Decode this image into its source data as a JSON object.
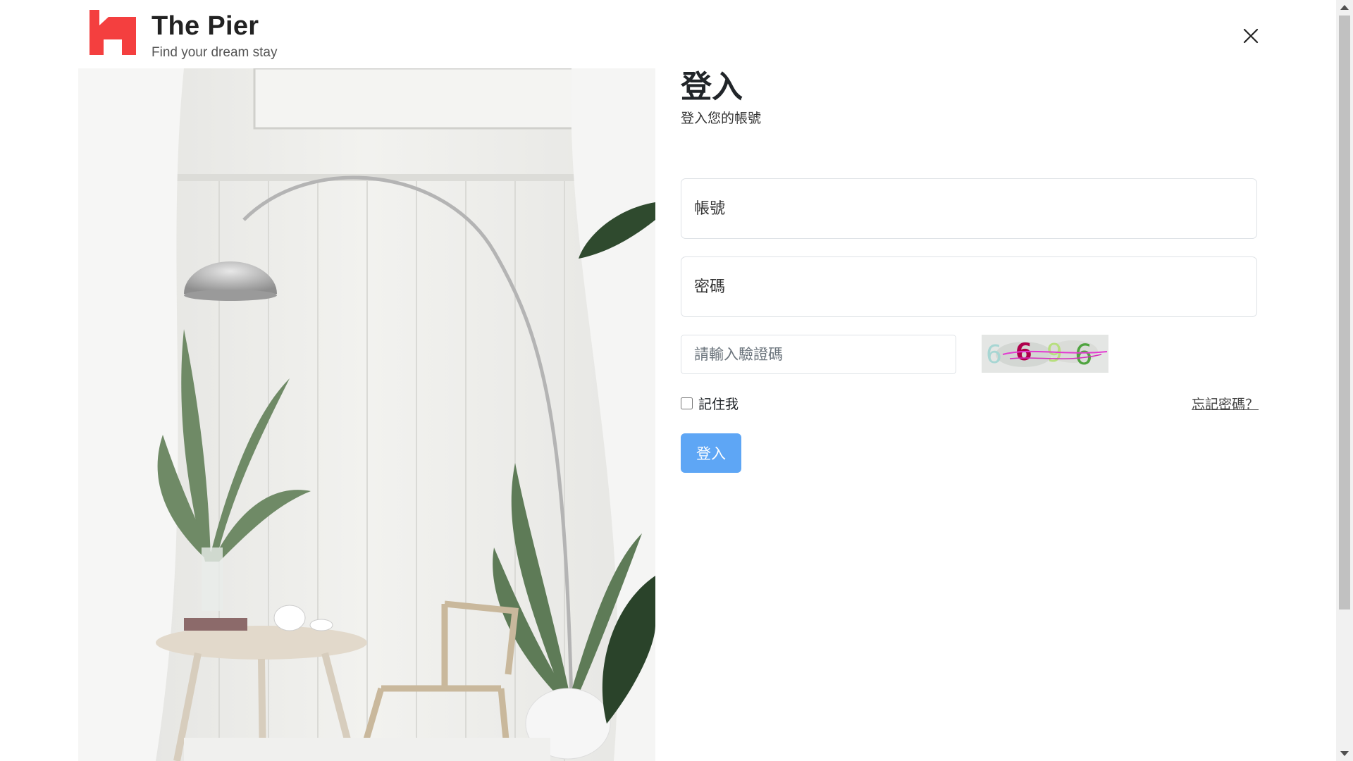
{
  "brand": {
    "name": "The Pier",
    "tagline": "Find your dream stay",
    "logo_icon": "house-logo-icon",
    "accent_color": "#f43f3f"
  },
  "header": {
    "close_icon": "close-icon"
  },
  "login": {
    "title": "登入",
    "subtitle": "登入您的帳號",
    "account_placeholder": "帳號",
    "password_placeholder": "密碼",
    "captcha_placeholder": "請輸入驗證碼",
    "captcha_text": "6696",
    "remember_label": "記住我",
    "remember_checked": false,
    "forgot_link": "忘記密碼？",
    "submit_label": "登入",
    "button_color": "#5ea6f5"
  }
}
